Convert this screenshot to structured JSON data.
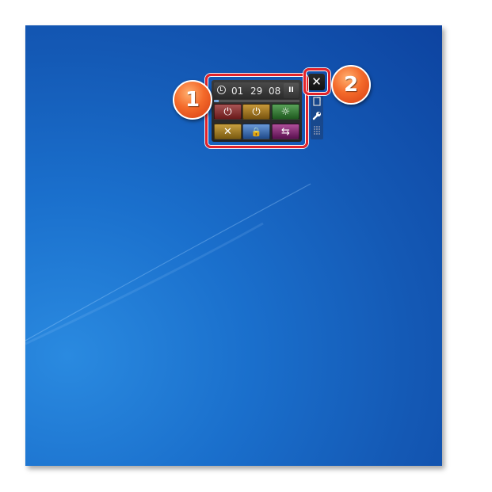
{
  "gadget": {
    "timer": {
      "hours": "01",
      "minutes": "29",
      "seconds": "08",
      "pause_symbol": "II",
      "progress": 0.06
    },
    "buttons": [
      {
        "name": "shutdown",
        "icon": "⏻",
        "color": "#8a3030"
      },
      {
        "name": "restart",
        "icon": "⏻",
        "color": "#a07a20"
      },
      {
        "name": "sleep",
        "icon": "☼",
        "color": "#2f7a2f"
      },
      {
        "name": "cancel",
        "icon": "✕",
        "color": "#a08030"
      },
      {
        "name": "lock",
        "icon": "🔒",
        "color": "#3a6ab0"
      },
      {
        "name": "switch-user",
        "icon": "⇆",
        "color": "#8a2a7a"
      }
    ]
  },
  "side_controls": {
    "close_symbol": "✕",
    "icons": [
      "resize-icon",
      "wrench-icon",
      "drag-grip-icon"
    ]
  },
  "callouts": {
    "first": "1",
    "second": "2"
  },
  "colors": {
    "highlight": "#e2232a",
    "callout": "#f46a2a",
    "desktop": "#1a6fcc"
  }
}
